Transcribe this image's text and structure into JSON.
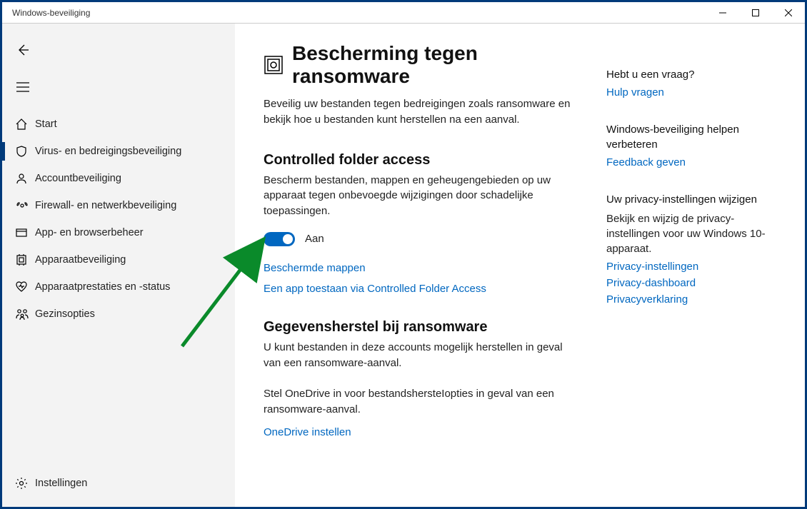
{
  "window": {
    "title": "Windows-beveiliging"
  },
  "sidebar": {
    "items": [
      {
        "label": "Start",
        "icon": "home",
        "selected": false
      },
      {
        "label": "Virus- en bedreigingsbeveiliging",
        "icon": "shield",
        "selected": true
      },
      {
        "label": "Accountbeveiliging",
        "icon": "account",
        "selected": false
      },
      {
        "label": "Firewall- en netwerkbeveiliging",
        "icon": "firewall",
        "selected": false
      },
      {
        "label": "App- en browserbeheer",
        "icon": "appbrowser",
        "selected": false
      },
      {
        "label": "Apparaatbeveiliging",
        "icon": "device",
        "selected": false
      },
      {
        "label": "Apparaatprestaties en -status",
        "icon": "health",
        "selected": false
      },
      {
        "label": "Gezinsopties",
        "icon": "family",
        "selected": false
      }
    ],
    "footer": {
      "label": "Instellingen",
      "icon": "gear"
    }
  },
  "main": {
    "title": "Bescherming tegen ransomware",
    "intro": "Beveilig uw bestanden tegen bedreigingen zoals ransomware en bekijk hoe u bestanden kunt herstellen na een aanval.",
    "cfa": {
      "heading": "Controlled folder access",
      "desc": "Bescherm bestanden, mappen en geheugengebieden op uw apparaat tegen onbevoegde wijzigingen door schadelijke toepassingen.",
      "toggle_state": "Aan",
      "link_protected": "Beschermde mappen",
      "link_allow": "Een app toestaan via Controlled Folder Access"
    },
    "recovery": {
      "heading": "Gegevensherstel bij ransomware",
      "desc": "U kunt bestanden in deze accounts mogelijk herstellen in geval van een ransomware-aanval.",
      "onedrive_hint": "Stel OneDrive in voor bestandshersteIopties in geval van een ransomware-aanval.",
      "link_setup": "OneDrive instellen"
    }
  },
  "aside": {
    "q": {
      "heading": "Hebt u een vraag?",
      "link": "Hulp vragen"
    },
    "improve": {
      "heading": "Windows-beveiliging helpen verbeteren",
      "link": "Feedback geven"
    },
    "privacy": {
      "heading": "Uw privacy-instellingen wijzigen",
      "desc": "Bekijk en wijzig de privacy-instellingen voor uw Windows 10-apparaat.",
      "link1": "Privacy-instellingen",
      "link2": "Privacy-dashboard",
      "link3": "Privacyverklaring"
    }
  }
}
